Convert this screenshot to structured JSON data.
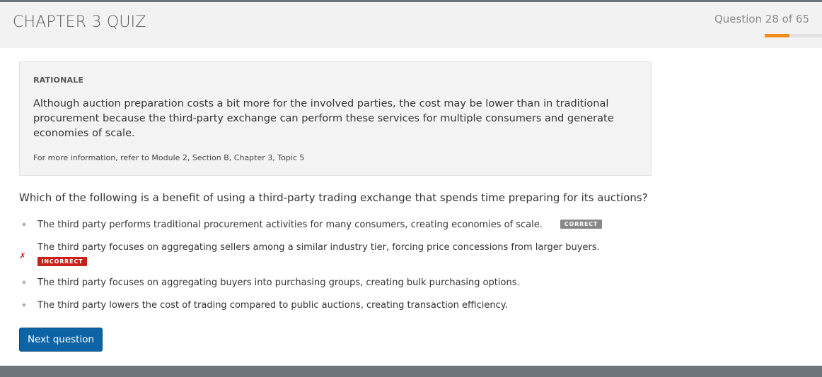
{
  "header": {
    "quiz_title": "CHAPTER 3 QUIZ",
    "question_counter": "Question 28 of 65",
    "progress_fraction": 0.43
  },
  "rationale": {
    "heading": "RATIONALE",
    "text": "Although auction preparation costs a bit more for the involved parties, the cost may be lower than in traditional procurement because the third-party exchange can perform these services for multiple consumers and generate economies of scale.",
    "reference": "For more information, refer to Module 2, Section B, Chapter 3, Topic 5"
  },
  "question": {
    "text": "Which of the following is a benefit of using a third-party trading exchange that spends time preparing for its auctions?"
  },
  "answers": [
    {
      "text": "The third party performs traditional procurement activities for many consumers, creating economies of scale.",
      "badge": "CORRECT",
      "marker_icon": "diamond-bullet-icon"
    },
    {
      "text": "The third party focuses on aggregating sellers among a similar industry tier, forcing price concessions from larger buyers.",
      "badge": "INCORRECT",
      "marker_icon": "x-mark-icon"
    },
    {
      "text": "The third party focuses on aggregating buyers into purchasing groups, creating bulk purchasing options.",
      "marker_icon": "diamond-bullet-icon"
    },
    {
      "text": "The third party lowers the cost of trading compared to public auctions, creating transaction efficiency.",
      "marker_icon": "diamond-bullet-icon"
    }
  ],
  "actions": {
    "next_label": "Next question"
  },
  "colors": {
    "accent_progress": "#f28c1a",
    "primary_button": "#0d64a5",
    "incorrect": "#c9211a",
    "correct_badge": "#888888",
    "header_bg": "#f2f2f2",
    "footer_bar": "#6d757b"
  }
}
